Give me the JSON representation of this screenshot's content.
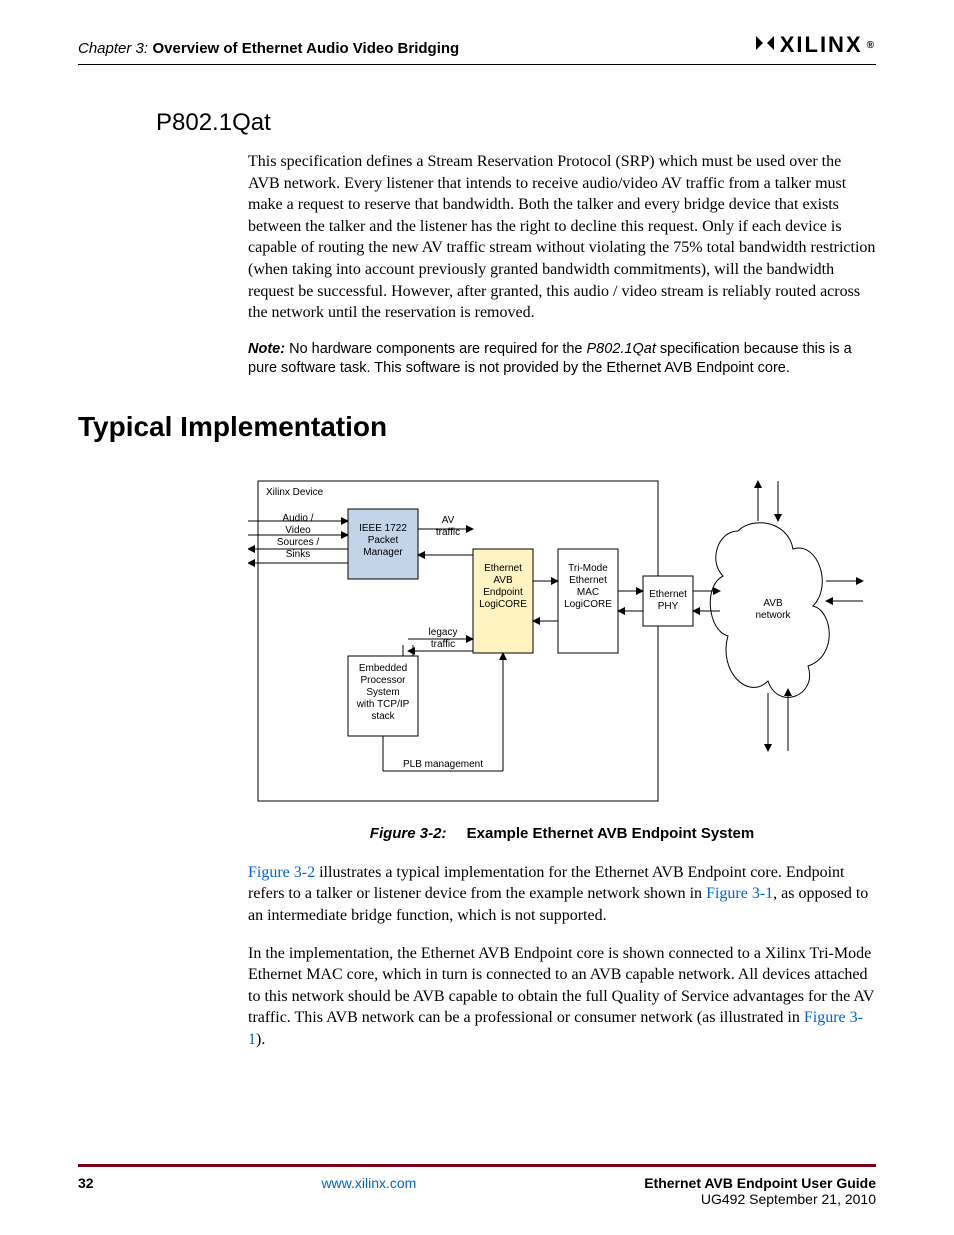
{
  "header": {
    "chapter_prefix": "Chapter 3:",
    "chapter_title": "Overview of Ethernet Audio Video Bridging",
    "logo_text": "XILINX"
  },
  "sub_heading": "P802.1Qat",
  "paragraphs": {
    "p1": "This specification defines a Stream Reservation Protocol (SRP) which must be used over the AVB network. Every listener that intends to receive audio/video AV traffic from a talker must make a request to reserve that bandwidth. Both the talker and every bridge device that exists between the talker and the listener has the right to decline this request. Only if each device is capable of routing the new AV traffic stream without violating the 75% total bandwidth restriction (when taking into account previously granted bandwidth commitments), will the bandwidth request be successful. However, after granted, this audio / video stream is reliably routed across the network until the reservation is removed."
  },
  "note": {
    "label": "Note:",
    "text_before": "No hardware components are required for the ",
    "italic": "P802.1Qat",
    "text_after": " specification because this is a pure software task. This software is not provided by the Ethernet AVB Endpoint core."
  },
  "section_title": "Typical Implementation",
  "figure": {
    "device_label": "Xilinx Device",
    "sources_label": "Audio /\nVideo\nSources /\nSinks",
    "ieee_label": "IEEE 1722\nPacket\nManager",
    "av_traffic": "AV\ntraffic",
    "avb_core": "Ethernet\nAVB\nEndpoint\nLogiCORE",
    "mac_core": "Tri-Mode\nEthernet\nMAC\nLogiCORE",
    "phy": "Ethernet\nPHY",
    "network": "AVB\nnetwork",
    "legacy": "legacy\ntraffic",
    "proc": "Embedded\nProcessor\nSystem\nwith TCP/IP\nstack",
    "plb": "PLB management",
    "caption_label": "Figure 3-2:",
    "caption_title": "Example Ethernet AVB Endpoint System"
  },
  "post_fig": {
    "p1_a": "Figure 3-2",
    "p1_b": " illustrates a typical implementation for the Ethernet AVB Endpoint core. Endpoint refers to a talker or listener device from the example network shown in ",
    "p1_c": "Figure 3-1",
    "p1_d": ", as opposed to an intermediate bridge function, which is not supported.",
    "p2_a": "In the implementation, the Ethernet AVB Endpoint core is shown connected to a Xilinx Tri-Mode Ethernet MAC core, which in turn is connected to an AVB capable network. All devices attached to this network should be AVB capable to obtain the full Quality of Service advantages for the AV traffic. This AVB network can be a professional or consumer network (as illustrated in ",
    "p2_b": "Figure 3-1",
    "p2_c": ")."
  },
  "footer": {
    "page": "32",
    "link": "www.xilinx.com",
    "guide": "Ethernet AVB Endpoint User Guide",
    "doc_id": "UG492 September 21, 2010"
  }
}
